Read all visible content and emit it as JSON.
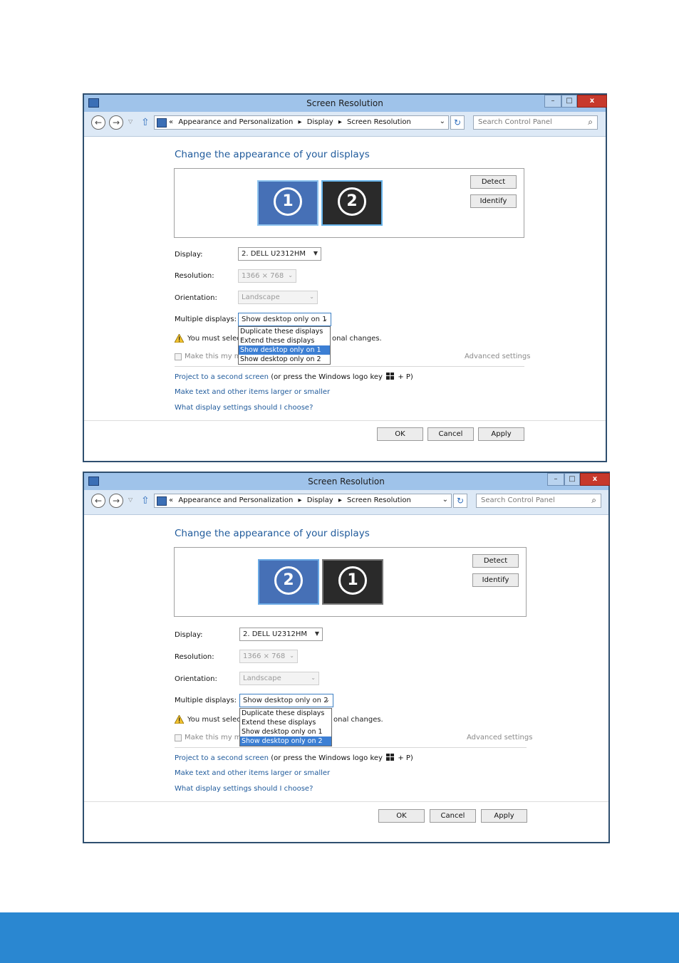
{
  "windows": [
    {
      "title": "Screen Resolution",
      "address": {
        "crumbs": [
          "«",
          "Appearance and Personalization",
          "▸",
          "Display",
          "▸",
          "Screen Resolution"
        ],
        "search_placeholder": "Search Control Panel"
      },
      "heading": "Change the appearance of your displays",
      "monitors": [
        "1",
        "2"
      ],
      "buttons": {
        "detect": "Detect",
        "identify": "Identify",
        "ok": "OK",
        "cancel": "Cancel",
        "apply": "Apply"
      },
      "labels": {
        "display": "Display:",
        "resolution": "Resolution:",
        "orientation": "Orientation:",
        "multiple": "Multiple displays:"
      },
      "values": {
        "display": "2. DELL U2312HM",
        "resolution": "1366 × 768",
        "orientation": "Landscape",
        "multiple": "Show desktop only on 1"
      },
      "dropdown_options": [
        "Duplicate these displays",
        "Extend these displays",
        "Show desktop only on 1",
        "Show desktop only on 2"
      ],
      "highlighted_option": "Show desktop only on 1",
      "warning": {
        "left": "You must select",
        "right": "onal changes."
      },
      "checkbox_label": "Make this my ma",
      "advanced": "Advanced settings",
      "links": {
        "project": "Project to a second screen",
        "project_suffix": " (or press the Windows logo key ",
        "project_end": " + P)",
        "larger": "Make text and other items larger or smaller",
        "choose": "What display settings should I choose?"
      }
    },
    {
      "title": "Screen Resolution",
      "address": {
        "crumbs": [
          "«",
          "Appearance and Personalization",
          "▸",
          "Display",
          "▸",
          "Screen Resolution"
        ],
        "search_placeholder": "Search Control Panel"
      },
      "heading": "Change the appearance of your displays",
      "monitors": [
        "2",
        "1"
      ],
      "buttons": {
        "detect": "Detect",
        "identify": "Identify",
        "ok": "OK",
        "cancel": "Cancel",
        "apply": "Apply"
      },
      "labels": {
        "display": "Display:",
        "resolution": "Resolution:",
        "orientation": "Orientation:",
        "multiple": "Multiple displays:"
      },
      "values": {
        "display": "2. DELL U2312HM",
        "resolution": "1366 × 768",
        "orientation": "Landscape",
        "multiple": "Show desktop only on 2"
      },
      "dropdown_options": [
        "Duplicate these displays",
        "Extend these displays",
        "Show desktop only on 1",
        "Show desktop only on 2"
      ],
      "highlighted_option": "Show desktop only on 2",
      "warning": {
        "left": "You must select",
        "right": "onal changes."
      },
      "checkbox_label": "Make this my ma",
      "advanced": "Advanced settings",
      "links": {
        "project": "Project to a second screen",
        "project_suffix": " (or press the Windows logo key ",
        "project_end": " + P)",
        "larger": "Make text and other items larger or smaller",
        "choose": "What display settings should I choose?"
      }
    }
  ],
  "colors": {
    "accent": "#1f5a9b",
    "highlight": "#3c7fd4",
    "bottom_bar": "#2a87d1",
    "close": "#c7392c"
  }
}
